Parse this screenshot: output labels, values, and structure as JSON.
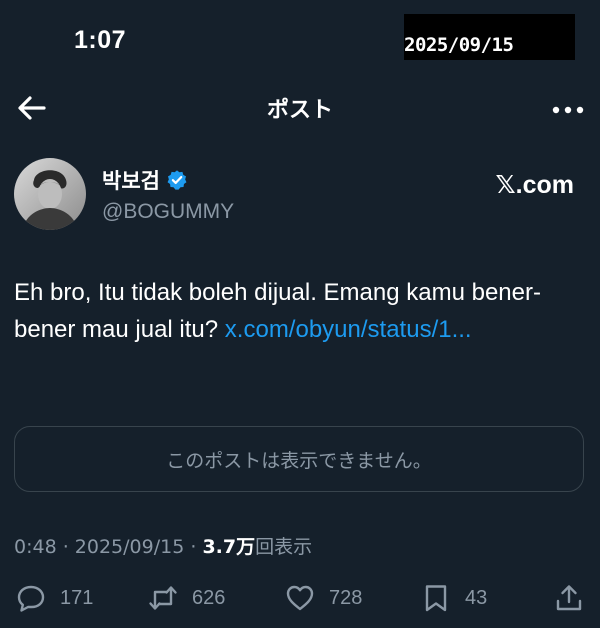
{
  "status_bar": {
    "time": "1:07"
  },
  "date_stamp": "2025/09/15",
  "header": {
    "title": "ポスト",
    "back_icon": "arrow-left-icon",
    "more_icon": "more-horizontal-icon"
  },
  "author": {
    "name": "박보검",
    "handle": "@BOGUMMY",
    "verified": true,
    "verified_color": "#1d9bf0"
  },
  "site_label": "𝕏.com",
  "tweet": {
    "text": "Eh bro, Itu tidak boleh dijual. Emang kamu bener-bener mau jual itu? ",
    "link": "x.com/obyun/status/1..."
  },
  "quote": {
    "unavailable_text": "このポストは表示できません。"
  },
  "meta": {
    "time": "0:48",
    "separator": " · ",
    "date": "2025/09/15",
    "views_count": "3.7万",
    "views_label": "回表示"
  },
  "actions": {
    "replies": "171",
    "reposts": "626",
    "likes": "728",
    "bookmarks": "43"
  },
  "colors": {
    "background": "#15202b",
    "accent": "#1d9bf0",
    "secondary_text": "#8b98a5"
  }
}
